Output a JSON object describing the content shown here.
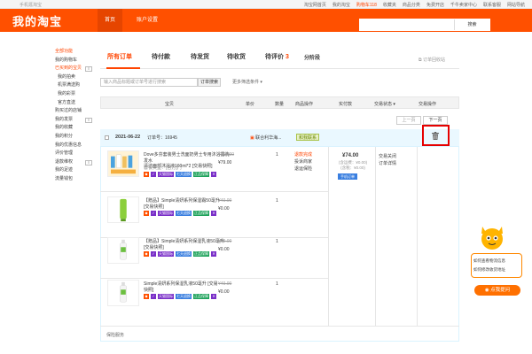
{
  "topbar": {
    "left": "手机逛淘宝",
    "links": [
      "淘宝网首页",
      "我的淘宝",
      "购物车118",
      "收藏夹",
      "商品分类",
      "免费开店",
      "千牛卖家中心",
      "联系客服",
      "网站导航"
    ]
  },
  "header": {
    "logo": "我的淘宝",
    "home": "首页",
    "account": "账户设置",
    "search_btn": "搜索"
  },
  "sidebar": {
    "items": [
      {
        "label": "全部功能",
        "type": "hd"
      },
      {
        "label": "我的购物车",
        "type": ""
      },
      {
        "label": "已买到的宝贝",
        "type": "cur",
        "tag": "≡"
      },
      {
        "label": "我的拍卖",
        "type": "sub"
      },
      {
        "label": "机票满送购",
        "type": "sub"
      },
      {
        "label": "我的彩票",
        "type": "sub"
      },
      {
        "label": "官方直送",
        "type": "sub"
      },
      {
        "label": "购买过的店铺",
        "type": ""
      },
      {
        "label": "我的发票",
        "type": "",
        "tag": "≡"
      },
      {
        "label": "我的收藏",
        "type": ""
      },
      {
        "label": "我的积分",
        "type": ""
      },
      {
        "label": "我的优惠信息",
        "type": ""
      },
      {
        "label": "评价管理",
        "type": ""
      },
      {
        "label": "退款维权",
        "type": "",
        "tag": "≡"
      },
      {
        "label": "我的足迹",
        "type": ""
      },
      {
        "label": "流量钱包",
        "type": ""
      }
    ]
  },
  "tabs": [
    {
      "label": "所有订单",
      "num": ""
    },
    {
      "label": "待付款",
      "num": ""
    },
    {
      "label": "待发货",
      "num": ""
    },
    {
      "label": "待收货",
      "num": ""
    },
    {
      "label": "待评价",
      "num": "3"
    },
    {
      "label": "分阶段",
      "num": ""
    }
  ],
  "recycle": "订单回收站",
  "order_search": {
    "placeholder": "输入商品标题或订单号进行搜索",
    "btn": "订单搜索",
    "more": "更多筛选条件"
  },
  "thead": [
    "宝贝",
    "单价",
    "数量",
    "商品操作",
    "实付款",
    "交易状态",
    "交易操作"
  ],
  "pager": {
    "prev": "上一页",
    "next": "下一页"
  },
  "order": {
    "date": "2021-06-22",
    "no": "订单号：16945",
    "shop": "联合利华海...",
    "contact": "和我联系",
    "total": "¥74.00",
    "ship": "(含运费：¥0.00)",
    "ship2": "(含税：¥0.00)",
    "mobile": "手机订单",
    "status": [
      "交易关闭",
      "订单详情"
    ],
    "items": [
      {
        "title": "Dove多芬套装男士洗面奶男士专用沐浴露洗发水",
        "title2": "清洁面部沐浴液160ml*2 [交易快照]",
        "attr": "套餐类型：[官方]门",
        "old": "¥158.00",
        "new": "¥79.00",
        "qty": "1",
        "ops": [
          "退款完成",
          "投诉商家",
          "退运保险"
        ]
      },
      {
        "title": "【赠品】Simple清妍系列保湿霜50毫升",
        "title2": "[交易快照]",
        "attr": "",
        "old": "¥40.00",
        "new": "¥0.00",
        "qty": "1",
        "ops": []
      },
      {
        "title": "【赠品】Simple清妍系列保湿乳液50毫升",
        "title2": "[交易快照]",
        "attr": "",
        "old": "¥40.00",
        "new": "¥0.00",
        "qty": "1",
        "ops": []
      },
      {
        "title": "Simple清妍系列保湿乳液50毫升 [交易",
        "title2": "快照]",
        "attr": "",
        "old": "¥40.00",
        "new": "¥0.00",
        "qty": "1",
        "ops": []
      }
    ],
    "badges": {
      "purple": "天猫国际",
      "blue": "七天退换",
      "green": "正品保障"
    },
    "service": "保险服务"
  },
  "widget": {
    "q1": "如何查看物流信息",
    "q2": "如何修改收货地址",
    "btn": "点我提问"
  },
  "colors": {
    "brand": "#ff5000",
    "accent": "#ff4400",
    "alert": "#e60000"
  }
}
